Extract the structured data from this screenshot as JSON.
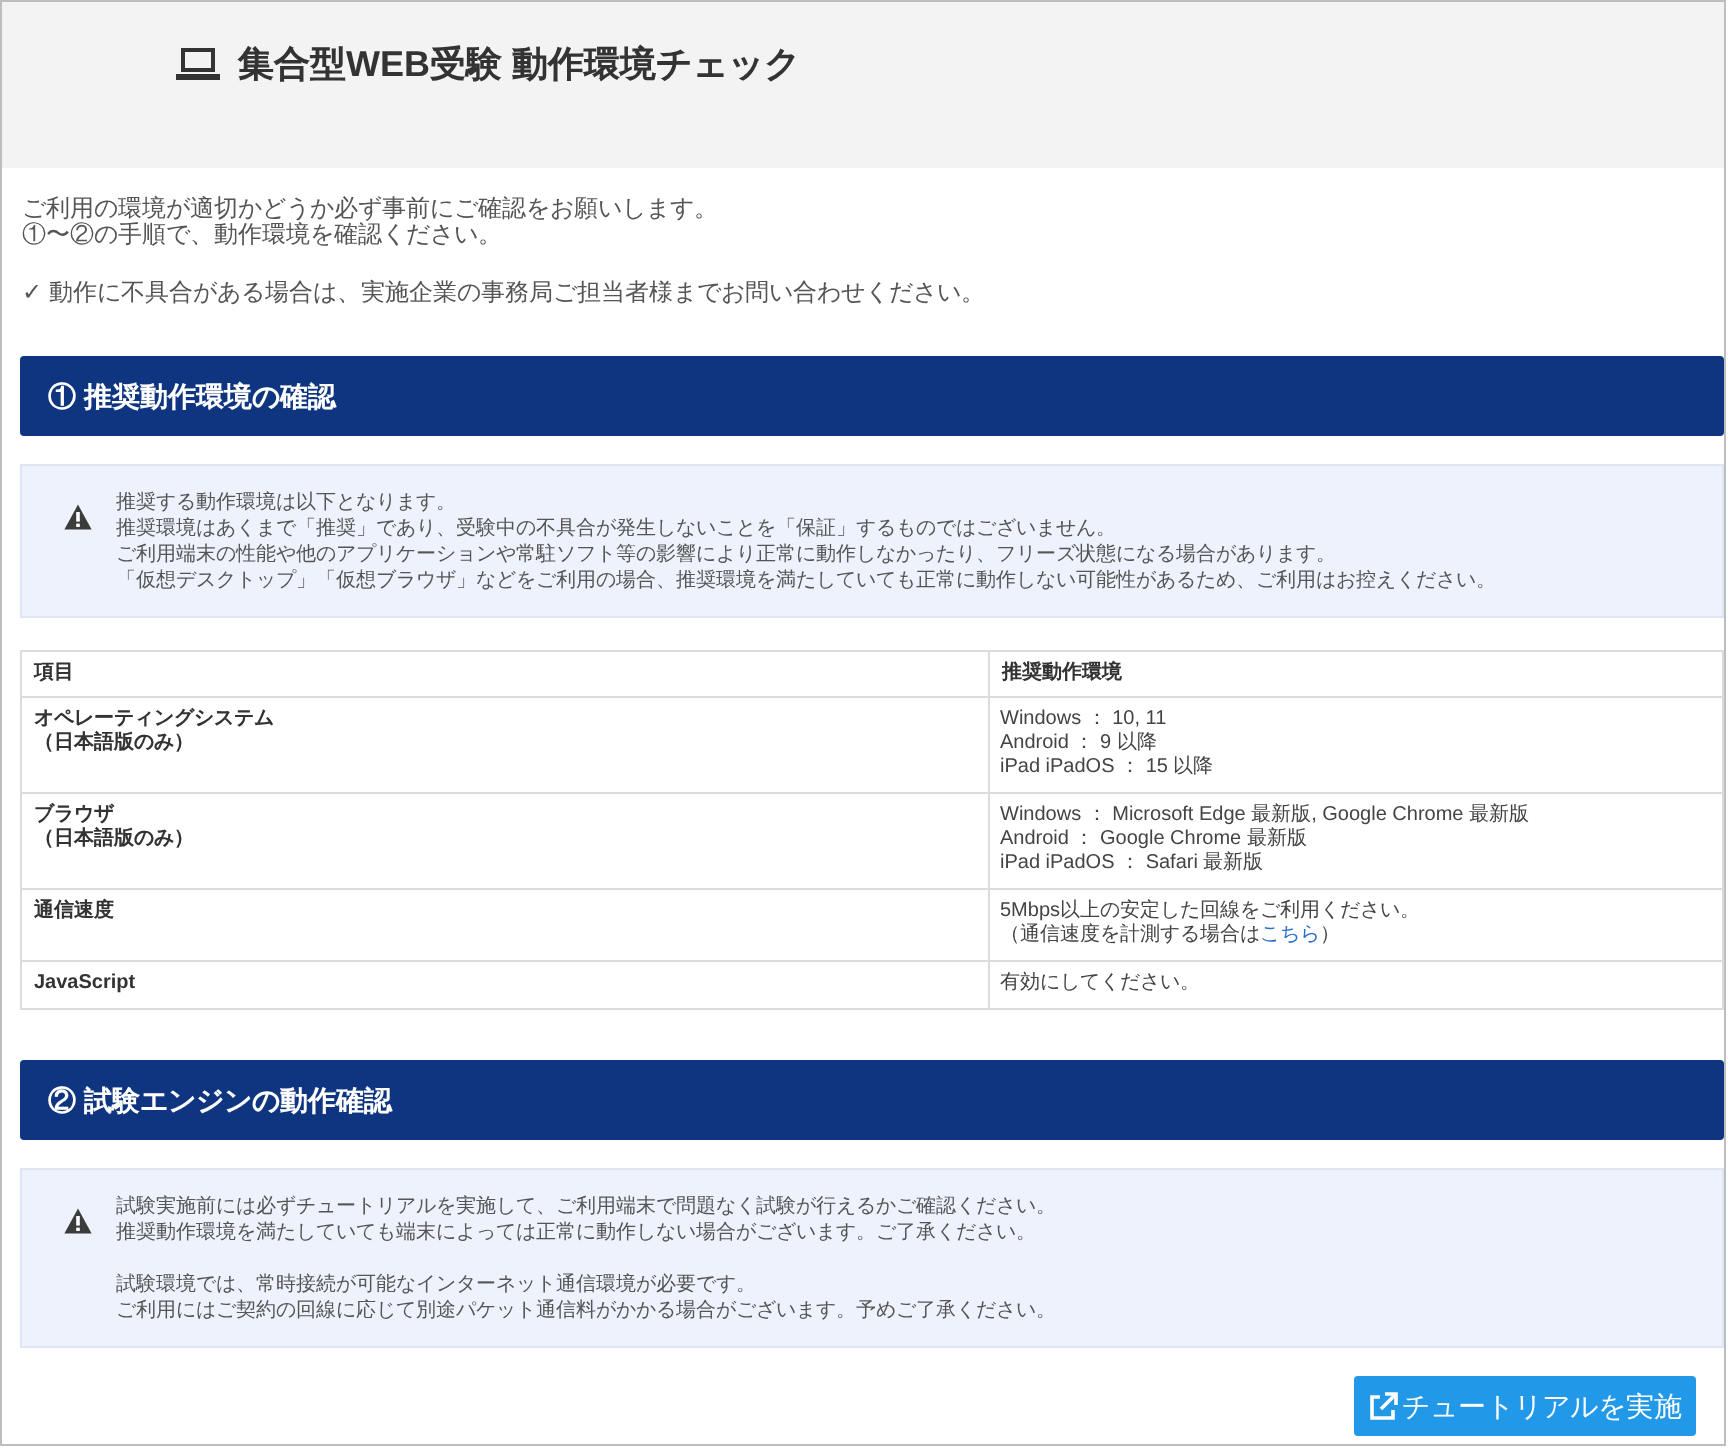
{
  "header": {
    "title": "集合型WEB受験 動作環境チェック"
  },
  "intro": {
    "lines": [
      "ご利用の環境が適切かどうか必ず事前にご確認をお願いします。",
      "①〜②の手順で、動作環境を確認ください。"
    ],
    "note": "✓ 動作に不具合がある場合は、実施企業の事務局ご担当者様までお問い合わせください。"
  },
  "sections": [
    {
      "title": "① 推奨動作環境の確認",
      "notice": {
        "paragraphs": [
          [
            "推奨する動作環境は以下となります。",
            "推奨環境はあくまで「推奨」であり、受験中の不具合が発生しないことを「保証」するものではございません。",
            "ご利用端末の性能や他のアプリケーションや常駐ソフト等の影響により正常に動作しなかったり、フリーズ状態になる場合があります。",
            "「仮想デスクトップ」「仮想ブラウザ」などをご利用の場合、推奨環境を満たしていても正常に動作しない可能性があるため、ご利用はお控えください。"
          ]
        ]
      },
      "table": {
        "columns": [
          "項目",
          "推奨動作環境"
        ],
        "rows": [
          {
            "item": [
              "オペレーティングシステム",
              "（日本語版のみ）"
            ],
            "spec": [
              {
                "text": "Windows ： 10, 11"
              },
              {
                "text": "Android ： 9 以降"
              },
              {
                "text": "iPad iPadOS ： 15 以降"
              }
            ]
          },
          {
            "item": [
              "ブラウザ",
              "（日本語版のみ）"
            ],
            "spec": [
              {
                "text": "Windows ： Microsoft Edge 最新版, Google Chrome 最新版"
              },
              {
                "text": "Android ： Google Chrome 最新版"
              },
              {
                "text": "iPad iPadOS ： Safari 最新版"
              }
            ]
          },
          {
            "item": [
              "通信速度"
            ],
            "spec": [
              {
                "text": "5Mbps以上の安定した回線をご利用ください。"
              },
              {
                "text": "（通信速度を計測する場合は",
                "link": "こちら",
                "after": "）"
              }
            ]
          },
          {
            "item": [
              "JavaScript"
            ],
            "spec": [
              {
                "text": "有効にしてください。"
              }
            ]
          }
        ]
      }
    },
    {
      "title": "② 試験エンジンの動作確認",
      "notice": {
        "paragraphs": [
          [
            "試験実施前には必ずチュートリアルを実施して、ご利用端末で問題なく試験が行えるかご確認ください。",
            "推奨動作環境を満たしていても端末によっては正常に動作しない場合がございます。ご了承ください。"
          ],
          [
            "試験環境では、常時接続が可能なインターネット通信環境が必要です。",
            "ご利用にはご契約の回線に応じて別途パケット通信料がかかる場合がございます。予めご了承ください。"
          ]
        ]
      },
      "button": {
        "label": "チュートリアルを実施"
      }
    }
  ]
}
